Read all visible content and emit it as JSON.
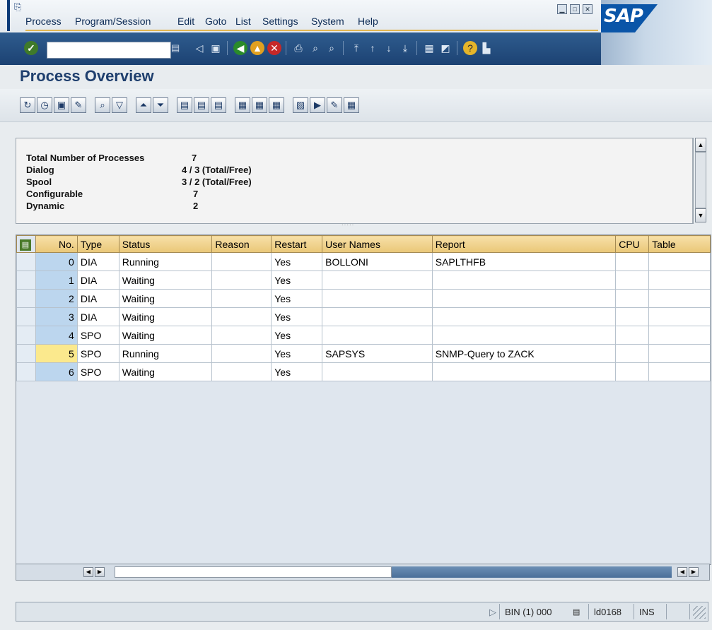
{
  "menu": {
    "items": [
      "Process",
      "Program/Session",
      "Edit",
      "Goto",
      "List",
      "Settings",
      "System",
      "Help"
    ]
  },
  "window": {
    "logo_text": "SAP"
  },
  "toolbar": {
    "command_field_value": "",
    "icons": [
      "enter-icon",
      "back-icon",
      "save-icon",
      "back-green-icon",
      "exit-icon",
      "cancel-icon",
      "print-icon",
      "find-icon",
      "find-next-icon",
      "first-page-icon",
      "previous-page-icon",
      "next-page-icon",
      "last-page-icon",
      "create-session-icon",
      "shortcut-icon",
      "help-icon",
      "customize-icon"
    ]
  },
  "page": {
    "title": "Process Overview"
  },
  "app_toolbar": {
    "icons": [
      "refresh-icon",
      "clock-icon",
      "details-icon",
      "debug-icon",
      "zoom-icon",
      "filter-icon",
      "sort-asc-icon",
      "sort-desc-icon",
      "layout-a-icon",
      "layout-b-icon",
      "layout-c-icon",
      "grid-icon",
      "grid-select-icon",
      "grid-expand-icon",
      "export-icon",
      "send-icon",
      "edit-icon",
      "calculator-icon"
    ]
  },
  "summary": {
    "rows": [
      {
        "label": "Total Number of Processes",
        "value": "7"
      },
      {
        "label": "Dialog",
        "value": "4 / 3 (Total/Free)"
      },
      {
        "label": "Spool",
        "value": "3 / 2 (Total/Free)"
      },
      {
        "label": "Configurable",
        "value": "7"
      },
      {
        "label": "Dynamic",
        "value": "2"
      }
    ]
  },
  "table": {
    "columns": [
      "No.",
      "Type",
      "Status",
      "Reason",
      "Restart",
      "User Names",
      "Report",
      "CPU",
      "Table"
    ],
    "rows": [
      {
        "no": "0",
        "type": "DIA",
        "status": "Running",
        "reason": "",
        "restart": "Yes",
        "user": "BOLLONI",
        "report": "SAPLTHFB",
        "cpu": "",
        "table": ""
      },
      {
        "no": "1",
        "type": "DIA",
        "status": "Waiting",
        "reason": "",
        "restart": "Yes",
        "user": "",
        "report": "",
        "cpu": "",
        "table": ""
      },
      {
        "no": "2",
        "type": "DIA",
        "status": "Waiting",
        "reason": "",
        "restart": "Yes",
        "user": "",
        "report": "",
        "cpu": "",
        "table": ""
      },
      {
        "no": "3",
        "type": "DIA",
        "status": "Waiting",
        "reason": "",
        "restart": "Yes",
        "user": "",
        "report": "",
        "cpu": "",
        "table": ""
      },
      {
        "no": "4",
        "type": "SPO",
        "status": "Waiting",
        "reason": "",
        "restart": "Yes",
        "user": "",
        "report": "",
        "cpu": "",
        "table": ""
      },
      {
        "no": "5",
        "type": "SPO",
        "status": "Running",
        "reason": "",
        "restart": "Yes",
        "user": "SAPSYS",
        "report": "SNMP-Query to ZACK",
        "cpu": "",
        "table": ""
      },
      {
        "no": "6",
        "type": "SPO",
        "status": "Waiting",
        "reason": "",
        "restart": "Yes",
        "user": "",
        "report": "",
        "cpu": "",
        "table": ""
      }
    ]
  },
  "status_bar": {
    "system": "BIN (1) 000",
    "server": "ld0168",
    "mode": "INS"
  }
}
